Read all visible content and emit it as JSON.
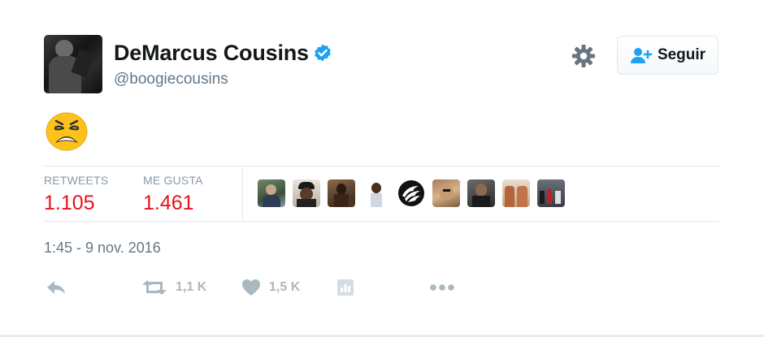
{
  "user": {
    "display_name": "DeMarcus Cousins",
    "handle": "@boogiecousins",
    "verified": true,
    "avatar_icon": "profile-photo"
  },
  "header": {
    "follow_label": "Seguir",
    "follow_icon": "add-user-icon",
    "settings_icon": "gear-icon"
  },
  "tweet": {
    "text_emoji": "weary-face-emoji",
    "timestamp": "1:45 - 9 nov. 2016"
  },
  "stats": {
    "retweets_label": "RETWEETS",
    "retweets_count": "1.105",
    "likes_label": "ME GUSTA",
    "likes_count": "1.461",
    "likers": [
      "liker-avatar",
      "liker-avatar",
      "liker-avatar",
      "liker-avatar",
      "raptors-logo",
      "liker-avatar",
      "liker-avatar",
      "liker-avatar",
      "liker-avatar"
    ]
  },
  "actions": {
    "reply_icon": "reply-icon",
    "retweet_icon": "retweet-icon",
    "retweet_count": "1,1 K",
    "like_icon": "heart-icon",
    "like_count": "1,5 K",
    "analytics_icon": "analytics-icon",
    "more_icon": "more-icon"
  },
  "colors": {
    "count_red": "#e8121b",
    "muted": "#657786",
    "verified_blue": "#1da1f2",
    "follow_blue": "#1da1f2",
    "action_gray": "#aab8c2"
  }
}
